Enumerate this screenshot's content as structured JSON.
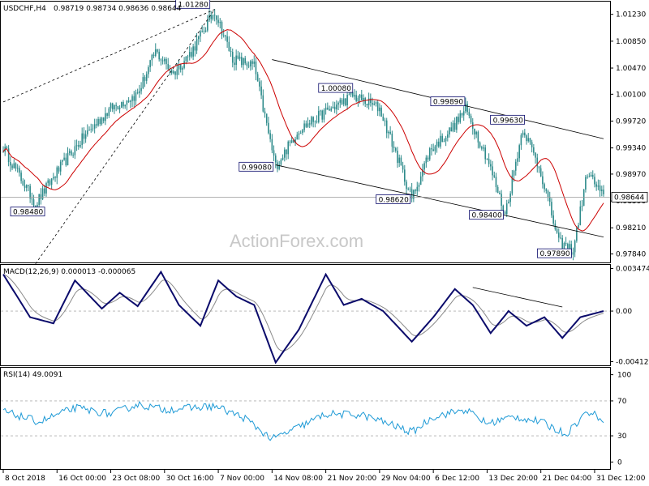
{
  "header": {
    "symbol": "USDCHF,H4",
    "ohlc": "0.98719 0.98734 0.98636 0.98644"
  },
  "watermark": "ActionForex.com",
  "colors": {
    "candle": "#2e8b8b",
    "ma": "#cc0000",
    "macd": "#0b0b6b",
    "signal": "#8a8a8a",
    "rsi": "#1e9ad6",
    "trend": "#000000",
    "current_price_line": "#9a9a9a"
  },
  "chart_data": [
    {
      "type": "candlestick",
      "title": "USDCHF,H4 0.98719 0.98734 0.98636 0.98644",
      "ylim": [
        0.9772,
        1.0141
      ],
      "y_ticks": [
        "1.01230",
        "1.00850",
        "1.00470",
        "1.00100",
        "0.99720",
        "0.99340",
        "0.98970",
        "0.98590",
        "0.98210",
        "0.97840"
      ],
      "current_price": "0.98644",
      "x_tick_labels": [
        "8 Oct 2018",
        "16 Oct 00:00",
        "23 Oct 08:00",
        "30 Oct 16:00",
        "7 Nov 00:00",
        "14 Nov 08:00",
        "21 Nov 20:00",
        "29 Nov 04:00",
        "6 Dec 12:00",
        "13 Dec 20:00",
        "21 Dec 04:00",
        "31 Dec 12:00"
      ],
      "annotations": [
        "1.01280",
        "0.98480",
        "0.99080",
        "1.00080",
        "0.98620",
        "0.99890",
        "0.98400",
        "0.99630",
        "0.97890"
      ],
      "close_path": [
        {
          "bar": 0,
          "close": 0.9935
        },
        {
          "bar": 10,
          "close": 0.989
        },
        {
          "bar": 18,
          "close": 0.9855
        },
        {
          "bar": 30,
          "close": 0.99
        },
        {
          "bar": 45,
          "close": 0.995
        },
        {
          "bar": 60,
          "close": 0.999
        },
        {
          "bar": 75,
          "close": 1.001
        },
        {
          "bar": 85,
          "close": 1.007
        },
        {
          "bar": 95,
          "close": 1.004
        },
        {
          "bar": 105,
          "close": 1.007
        },
        {
          "bar": 118,
          "close": 1.0128
        },
        {
          "bar": 128,
          "close": 1.006
        },
        {
          "bar": 140,
          "close": 1.005
        },
        {
          "bar": 145,
          "close": 0.999
        },
        {
          "bar": 152,
          "close": 0.9908
        },
        {
          "bar": 165,
          "close": 0.996
        },
        {
          "bar": 180,
          "close": 0.9985
        },
        {
          "bar": 195,
          "close": 1.0008
        },
        {
          "bar": 210,
          "close": 0.999
        },
        {
          "bar": 220,
          "close": 0.992
        },
        {
          "bar": 228,
          "close": 0.9862
        },
        {
          "bar": 238,
          "close": 0.993
        },
        {
          "bar": 250,
          "close": 0.996
        },
        {
          "bar": 258,
          "close": 0.9989
        },
        {
          "bar": 270,
          "close": 0.992
        },
        {
          "bar": 280,
          "close": 0.984
        },
        {
          "bar": 290,
          "close": 0.9963
        },
        {
          "bar": 300,
          "close": 0.99
        },
        {
          "bar": 310,
          "close": 0.98
        },
        {
          "bar": 318,
          "close": 0.9789
        },
        {
          "bar": 326,
          "close": 0.99
        },
        {
          "bar": 335,
          "close": 0.9864
        }
      ],
      "bar_count": 336
    },
    {
      "type": "line",
      "title": "MACD(12,26,9) 0.000013 -0.000065",
      "ylim": [
        -0.004129,
        0.003474
      ],
      "y_ticks": [
        "0.003474",
        "0.00",
        "-0.004129"
      ],
      "macd_path": [
        {
          "bar": 0,
          "v": 0.003
        },
        {
          "bar": 15,
          "v": -0.0005
        },
        {
          "bar": 28,
          "v": -0.001
        },
        {
          "bar": 40,
          "v": 0.0025
        },
        {
          "bar": 55,
          "v": 0.0002
        },
        {
          "bar": 65,
          "v": 0.0015
        },
        {
          "bar": 75,
          "v": 0.0004
        },
        {
          "bar": 88,
          "v": 0.0032
        },
        {
          "bar": 98,
          "v": 0.0005
        },
        {
          "bar": 110,
          "v": -0.0012
        },
        {
          "bar": 120,
          "v": 0.0025
        },
        {
          "bar": 130,
          "v": 0.0012
        },
        {
          "bar": 140,
          "v": 0.0005
        },
        {
          "bar": 152,
          "v": -0.0042
        },
        {
          "bar": 165,
          "v": -0.0015
        },
        {
          "bar": 180,
          "v": 0.003
        },
        {
          "bar": 190,
          "v": 0.0005
        },
        {
          "bar": 200,
          "v": 0.001
        },
        {
          "bar": 212,
          "v": 0.0
        },
        {
          "bar": 228,
          "v": -0.0025
        },
        {
          "bar": 240,
          "v": -0.0005
        },
        {
          "bar": 252,
          "v": 0.0018
        },
        {
          "bar": 262,
          "v": 0.0005
        },
        {
          "bar": 272,
          "v": -0.0018
        },
        {
          "bar": 282,
          "v": 0.0
        },
        {
          "bar": 292,
          "v": -0.0012
        },
        {
          "bar": 302,
          "v": -0.0005
        },
        {
          "bar": 312,
          "v": -0.0022
        },
        {
          "bar": 322,
          "v": -0.0005
        },
        {
          "bar": 335,
          "v": 0.0
        }
      ]
    },
    {
      "type": "line",
      "title": "RSI(14) 49.0091",
      "ylim": [
        0,
        100
      ],
      "y_ticks": [
        "100",
        "70",
        "30",
        "0"
      ],
      "rsi_path": [
        {
          "bar": 0,
          "v": 58
        },
        {
          "bar": 20,
          "v": 46
        },
        {
          "bar": 40,
          "v": 62
        },
        {
          "bar": 60,
          "v": 55
        },
        {
          "bar": 75,
          "v": 66
        },
        {
          "bar": 90,
          "v": 60
        },
        {
          "bar": 105,
          "v": 62
        },
        {
          "bar": 118,
          "v": 64
        },
        {
          "bar": 135,
          "v": 50
        },
        {
          "bar": 150,
          "v": 26
        },
        {
          "bar": 165,
          "v": 40
        },
        {
          "bar": 180,
          "v": 55
        },
        {
          "bar": 200,
          "v": 54
        },
        {
          "bar": 215,
          "v": 44
        },
        {
          "bar": 228,
          "v": 34
        },
        {
          "bar": 240,
          "v": 52
        },
        {
          "bar": 258,
          "v": 60
        },
        {
          "bar": 270,
          "v": 44
        },
        {
          "bar": 285,
          "v": 52
        },
        {
          "bar": 300,
          "v": 46
        },
        {
          "bar": 314,
          "v": 32
        },
        {
          "bar": 326,
          "v": 58
        },
        {
          "bar": 335,
          "v": 49
        }
      ]
    }
  ]
}
